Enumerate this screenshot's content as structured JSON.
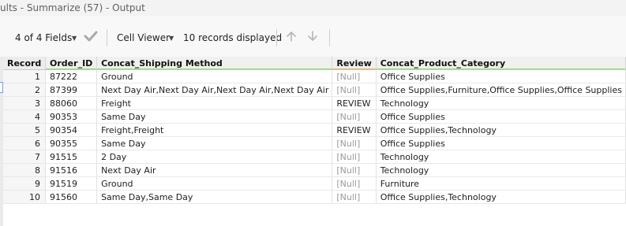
{
  "window": {
    "title": "ults - Summarize (57) - Output"
  },
  "toolbar": {
    "fields_label": "4 of 4 Fields",
    "viewer_label": "Cell Viewer",
    "records_label": "10 records displayed"
  },
  "grid": {
    "columns": [
      "Record",
      "Order_ID",
      "Concat_Shipping Method",
      "Review",
      "Concat_Product_Category"
    ],
    "rows": [
      [
        "1",
        "87222",
        "Ground",
        "[Null]",
        "Office Supplies"
      ],
      [
        "2",
        "87399",
        "Next Day Air,Next Day Air,Next Day Air,Next Day Air",
        "[Null]",
        "Office Supplies,Furniture,Office Supplies,Office Supplies"
      ],
      [
        "3",
        "88060",
        "Freight",
        "REVIEW",
        "Technology"
      ],
      [
        "4",
        "90353",
        "Same Day",
        "[Null]",
        "Office Supplies"
      ],
      [
        "5",
        "90354",
        "Freight,Freight",
        "REVIEW",
        "Office Supplies,Technology"
      ],
      [
        "6",
        "90355",
        "Same Day",
        "[Null]",
        "Office Supplies"
      ],
      [
        "7",
        "91515",
        "2 Day",
        "[Null]",
        "Technology"
      ],
      [
        "8",
        "91516",
        "Next Day Air",
        "[Null]",
        "Technology"
      ],
      [
        "9",
        "91519",
        "Ground",
        "[Null]",
        "Furniture"
      ],
      [
        "10",
        "91560",
        "Same Day,Same Day",
        "[Null]",
        "Office Supplies,Technology"
      ]
    ]
  },
  "icons": {
    "check": "checkmark-icon",
    "up": "arrow-up-icon",
    "down": "arrow-down-icon",
    "caret": "caret-down-icon"
  },
  "colors": {
    "header_underline_green": "#8cdd6c",
    "header_underline_orange": "#f0b05a",
    "null_text": "#9a9a9a"
  }
}
